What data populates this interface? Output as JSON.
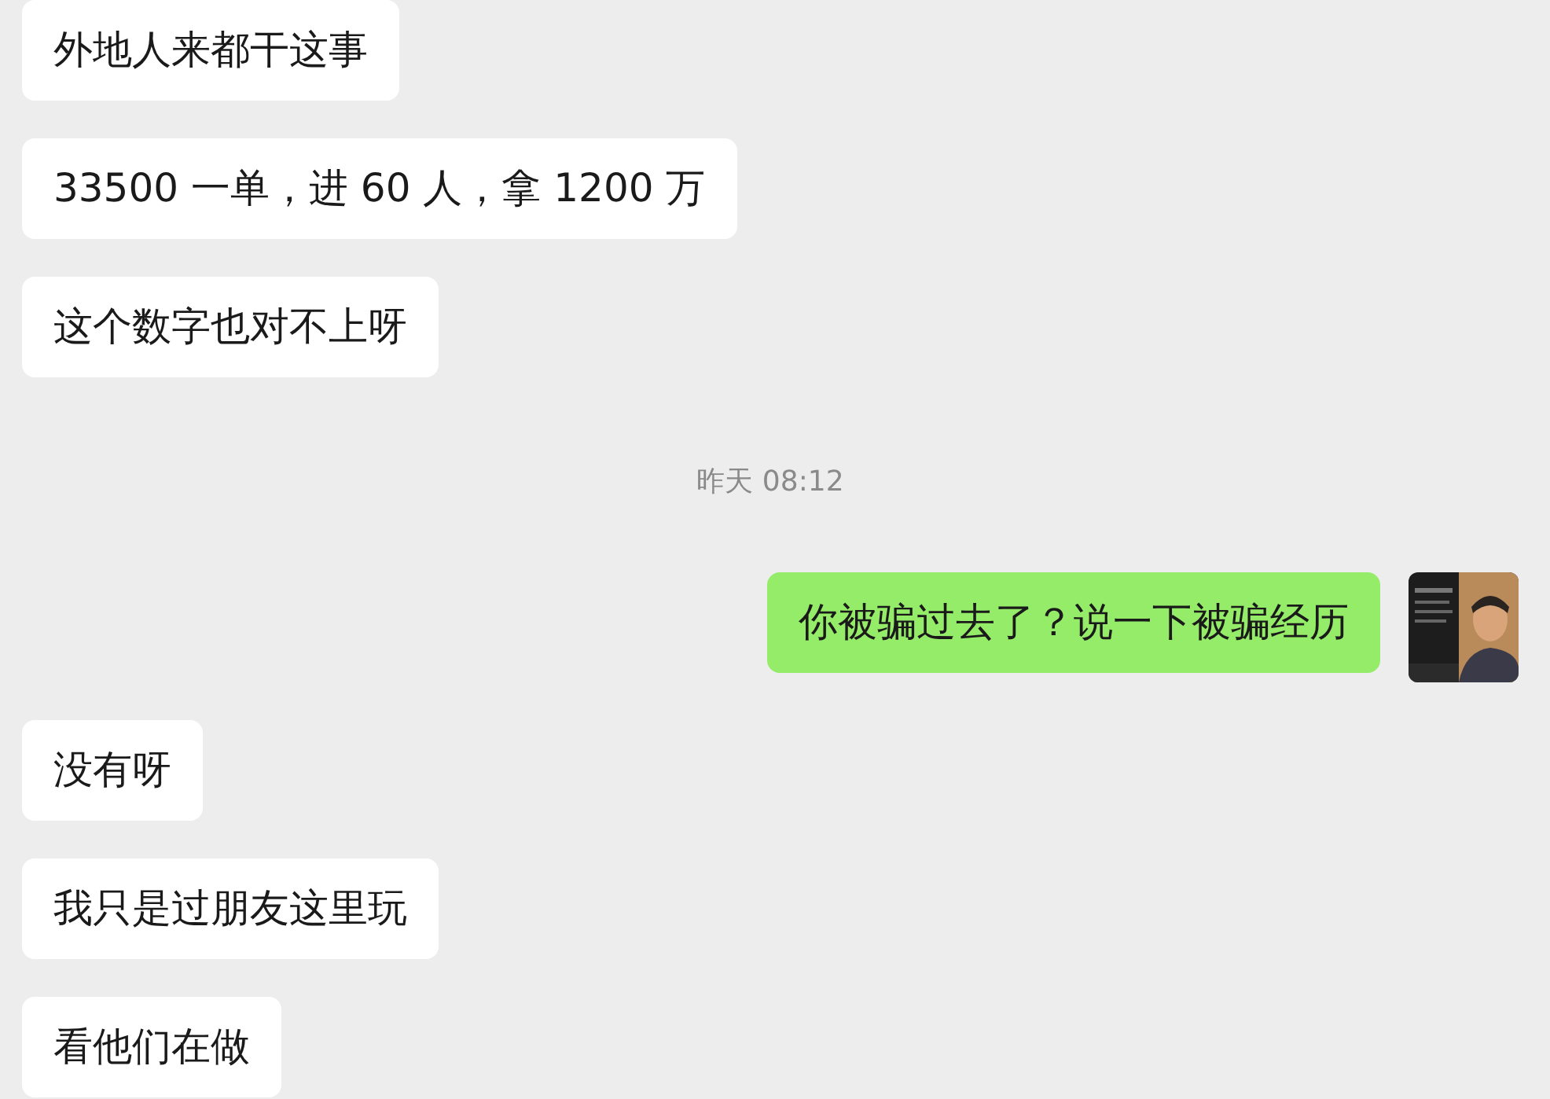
{
  "messages": [
    {
      "kind": "incoming",
      "text": "外地人来都干这事"
    },
    {
      "kind": "incoming",
      "text": "33500 一单，进 60 人，拿 1200 万"
    },
    {
      "kind": "incoming",
      "text": "这个数字也对不上呀"
    },
    {
      "kind": "time",
      "text": "昨天 08:12"
    },
    {
      "kind": "outgoing",
      "text": "你被骗过去了？说一下被骗经历"
    },
    {
      "kind": "incoming",
      "text": "没有呀"
    },
    {
      "kind": "incoming",
      "text": "我只是过朋友这里玩"
    },
    {
      "kind": "incoming",
      "text": "看他们在做"
    }
  ]
}
